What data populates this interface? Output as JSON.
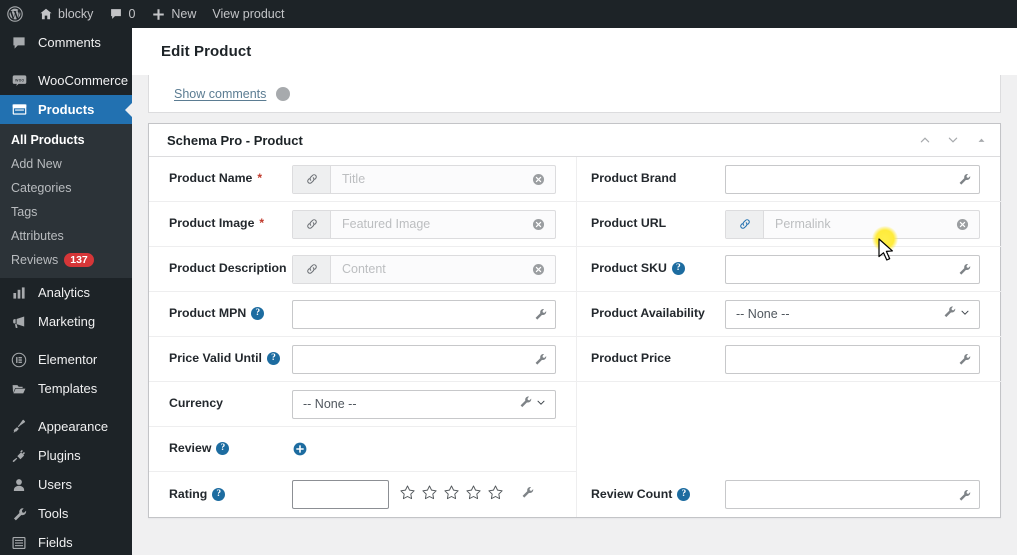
{
  "adminbar": {
    "items": [
      {
        "icon": "wordpress-logo-icon",
        "label": ""
      },
      {
        "icon": "home-icon",
        "label": "blocky"
      },
      {
        "icon": "comment-bubble-icon",
        "label": "0"
      },
      {
        "icon": "plus-icon",
        "label": "New"
      },
      {
        "icon": "",
        "label": "View product"
      }
    ]
  },
  "sidebar": {
    "items": [
      {
        "label": "Comments",
        "icon": "comment-bubble-icon",
        "current": false
      },
      {
        "label": "WooCommerce",
        "icon": "woocommerce-icon",
        "current": false
      },
      {
        "label": "Products",
        "icon": "products-box-icon",
        "current": true
      }
    ],
    "submenu": [
      {
        "label": "All Products",
        "current": true,
        "badge": ""
      },
      {
        "label": "Add New",
        "current": false,
        "badge": ""
      },
      {
        "label": "Categories",
        "current": false,
        "badge": ""
      },
      {
        "label": "Tags",
        "current": false,
        "badge": ""
      },
      {
        "label": "Attributes",
        "current": false,
        "badge": ""
      },
      {
        "label": "Reviews",
        "current": false,
        "badge": "137"
      }
    ],
    "items_lower": [
      {
        "label": "Analytics",
        "icon": "bar-chart-icon"
      },
      {
        "label": "Marketing",
        "icon": "megaphone-icon"
      },
      {
        "label": "Elementor",
        "icon": "elementor-icon"
      },
      {
        "label": "Templates",
        "icon": "folder-icon"
      },
      {
        "label": "Appearance",
        "icon": "paintbrush-icon"
      },
      {
        "label": "Plugins",
        "icon": "plug-icon"
      },
      {
        "label": "Users",
        "icon": "user-icon"
      },
      {
        "label": "Tools",
        "icon": "wrench-icon"
      },
      {
        "label": "Fields",
        "icon": "list-icon"
      }
    ]
  },
  "page": {
    "title": "Edit Product",
    "show_comments_label": "Show comments"
  },
  "panel": {
    "title": "Schema Pro - Product",
    "actions": [
      {
        "name": "move-up-button",
        "icon": "chevron-up-icon"
      },
      {
        "name": "move-down-button",
        "icon": "chevron-down-icon"
      },
      {
        "name": "toggle-panel-button",
        "icon": "triangle-up-icon"
      }
    ]
  },
  "fields": {
    "product_name": {
      "label": "Product Name",
      "required": true,
      "help": false,
      "type": "mapped",
      "placeholder": "Title"
    },
    "product_brand": {
      "label": "Product Brand",
      "required": false,
      "help": false,
      "type": "plain",
      "value": ""
    },
    "product_image": {
      "label": "Product Image",
      "required": true,
      "help": false,
      "type": "mapped",
      "placeholder": "Featured Image"
    },
    "product_url": {
      "label": "Product URL",
      "required": false,
      "help": false,
      "type": "mapped",
      "placeholder": "Permalink"
    },
    "product_description": {
      "label": "Product Description",
      "required": false,
      "help": false,
      "type": "mapped",
      "placeholder": "Content"
    },
    "product_sku": {
      "label": "Product SKU",
      "required": false,
      "help": true,
      "type": "plain",
      "value": ""
    },
    "product_mpn": {
      "label": "Product MPN",
      "required": false,
      "help": true,
      "type": "plain",
      "value": ""
    },
    "product_availability": {
      "label": "Product Availability",
      "required": false,
      "help": false,
      "type": "select",
      "value": "-- None --"
    },
    "price_valid_until": {
      "label": "Price Valid Until",
      "required": false,
      "help": true,
      "type": "plain",
      "value": ""
    },
    "product_price": {
      "label": "Product Price",
      "required": false,
      "help": false,
      "type": "plain",
      "value": ""
    },
    "currency": {
      "label": "Currency",
      "required": false,
      "help": false,
      "type": "select",
      "value": "-- None --"
    },
    "review": {
      "label": "Review",
      "required": false,
      "help": true,
      "type": "add"
    },
    "rating": {
      "label": "Rating",
      "required": false,
      "help": true,
      "type": "rating",
      "value": "",
      "stars": 5,
      "filled": 0
    },
    "review_count": {
      "label": "Review Count",
      "required": false,
      "help": true,
      "type": "plain",
      "value": ""
    }
  },
  "colors": {
    "admin_dark": "#1d2327",
    "admin_accent": "#2271b1",
    "badge_red": "#d63638",
    "help_blue": "#1d6ca0",
    "required_red": "#c0392b",
    "cursor_highlight": "#ffeb3b"
  }
}
